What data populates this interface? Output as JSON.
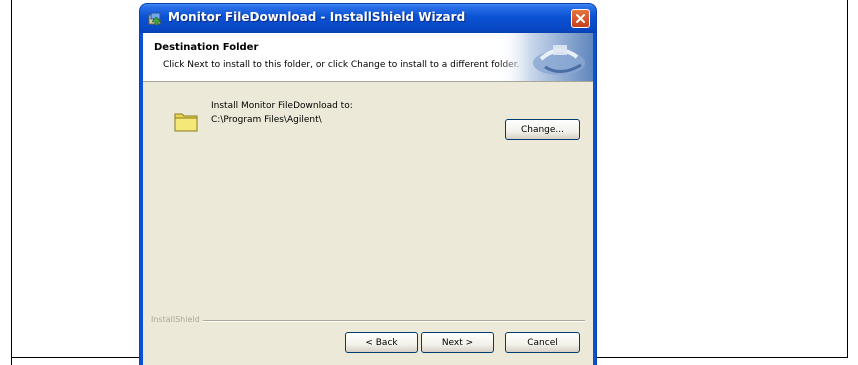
{
  "window": {
    "title": "Monitor FileDownload - InstallShield Wizard"
  },
  "header": {
    "title": "Destination Folder",
    "description": "Click Next to install to this folder, or click Change to install to a different folder."
  },
  "body": {
    "install_label": "Install Monitor FileDownload to:",
    "install_path": "C:\\Program Files\\Agilent\\",
    "change_button": "Change..."
  },
  "footer": {
    "brand": "InstallShield",
    "back_button": "< Back",
    "next_button": "Next >",
    "cancel_button": "Cancel"
  },
  "colors": {
    "titlebar": "#0a52d4",
    "client_background": "#ece9d8",
    "header_background": "#ffffff",
    "close_button": "#c4401c",
    "folder": "#f0e06a"
  },
  "icons": {
    "title": "installer-icon",
    "close": "close-icon",
    "folder": "folder-icon",
    "header": "installshield-graphic"
  }
}
